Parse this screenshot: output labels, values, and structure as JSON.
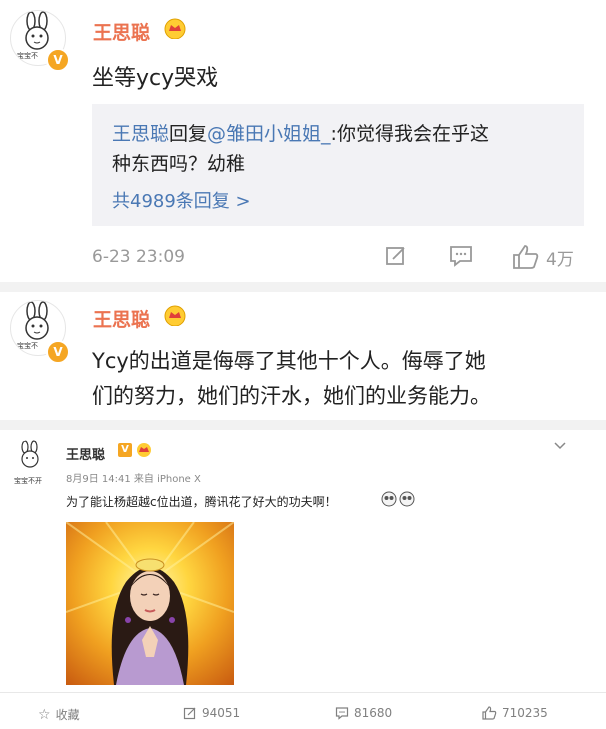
{
  "post1": {
    "avatar_caption": "宝宝不",
    "username": "王思聪",
    "content": "坐等ycy哭戏",
    "reply": {
      "author": "王思聪",
      "action": "回复",
      "mention": "@雏田小姐姐_",
      "text_line1": ":你觉得我会在乎这",
      "text_line2": "种东西吗？幼稚",
      "more": "共4989条回复 >"
    },
    "time": "6-23 23:09",
    "like_count": "4万"
  },
  "post2": {
    "avatar_caption": "宝宝不",
    "username": "王思聪",
    "content_line1": "Ycy的出道是侮辱了其他十个人。侮辱了她",
    "content_line2": "们的努力，她们的汗水，她们的业务能力。"
  },
  "post3": {
    "avatar_caption": "宝宝不开",
    "username": "王思聪",
    "meta": "8月9日 14:41 来自 iPhone X",
    "content": "为了能让杨超越c位出道，腾讯花了好大的功夫啊！",
    "actions": {
      "favorite_label": "收藏",
      "repost_count": "94051",
      "comment_count": "81680",
      "like_count": "710235"
    }
  },
  "colors": {
    "username": "#eb7350",
    "link": "#4a78b4",
    "meta": "#999999",
    "reply_bg": "#f2f2f5"
  }
}
